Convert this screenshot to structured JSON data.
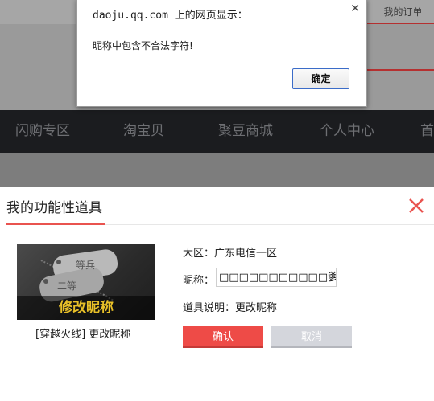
{
  "background": {
    "top_link": "我的订单",
    "nav": [
      "闪购专区",
      "淘宝贝",
      "聚豆商城",
      "个人中心",
      "首"
    ]
  },
  "alert": {
    "title": "daoju.qq.com 上的网页显示：",
    "close_icon": "close-icon",
    "message": "昵称中包含不合法字符!",
    "ok_label": "确定"
  },
  "panel": {
    "title": "我的功能性道具",
    "close_icon": "close-icon",
    "item": {
      "banner_text": "修改昵称",
      "caption": "[穿越火线] 更改昵称",
      "tag_text_1": "等兵",
      "tag_text_2": "二等"
    },
    "server_label": "大区：",
    "server_value": "广东电信一区",
    "nickname_label": "昵称：",
    "nickname_value": "□□□□□□□□□□□爹",
    "desc_label": "道具说明：",
    "desc_value": "更改昵称",
    "confirm_label": "确认",
    "cancel_label": "取消"
  },
  "colors": {
    "accent_red": "#ee4b47",
    "cancel_grey": "#d4d6dc",
    "nav_bg": "#1b1c1f",
    "overlay_grey": "#9a9a9a"
  }
}
